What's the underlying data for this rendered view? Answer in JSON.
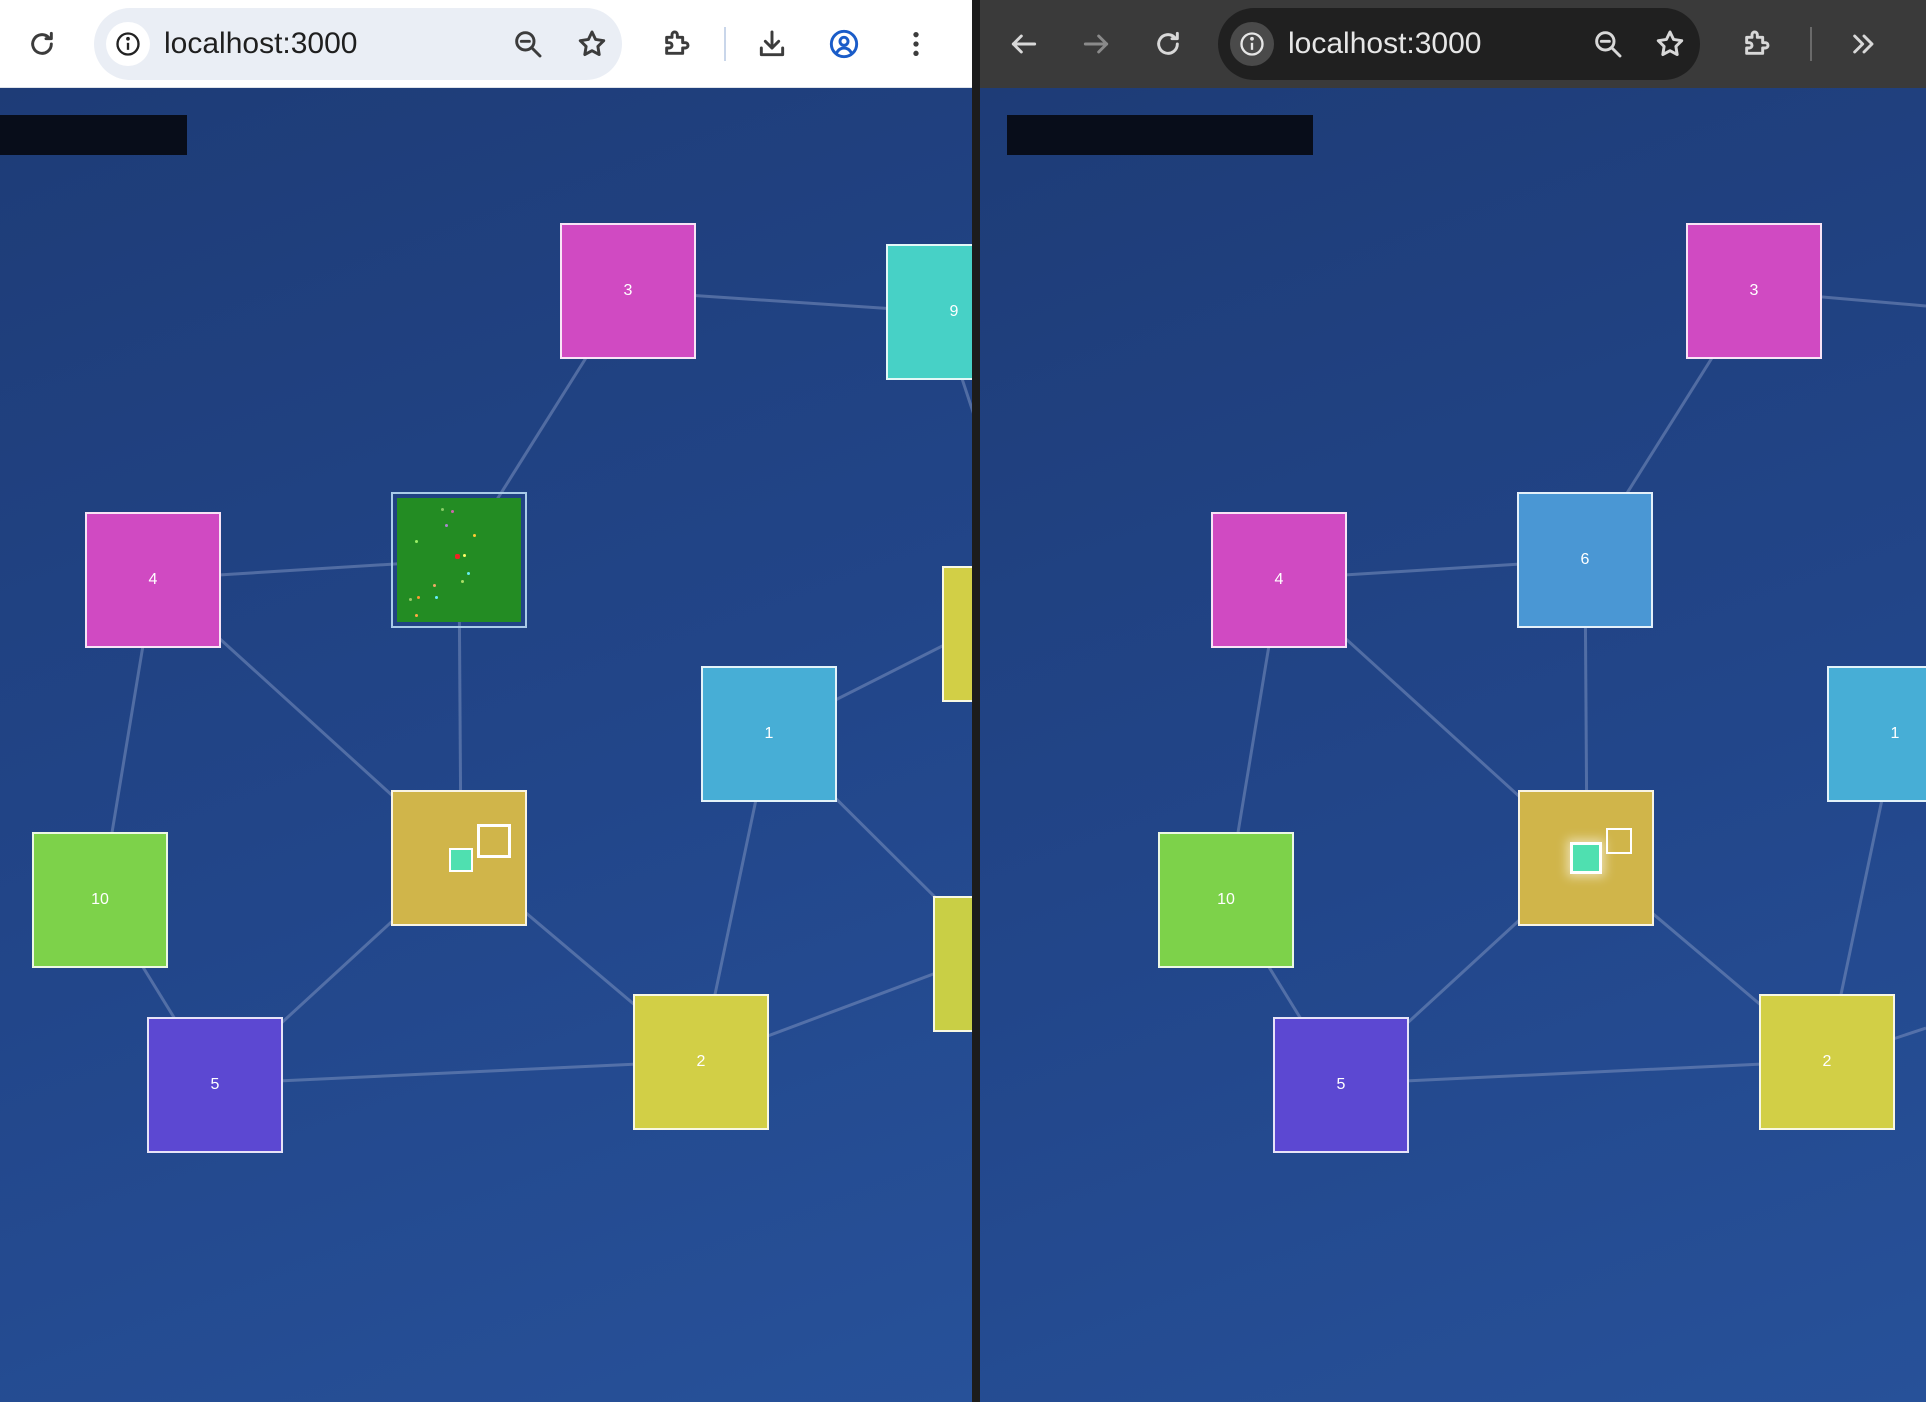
{
  "left_window": {
    "theme": "light",
    "url": "localhost:3000",
    "toolbar_icons": [
      "reload-icon",
      "zoom-out-icon",
      "bookmark-star-icon",
      "extensions-icon",
      "download-icon",
      "profile-icon",
      "menu-icon"
    ]
  },
  "right_window": {
    "theme": "dark",
    "url": "localhost:3000",
    "toolbar_icons": [
      "back-icon",
      "forward-icon",
      "reload-icon",
      "zoom-out-icon",
      "bookmark-star-icon",
      "extensions-icon",
      "overflow-icon"
    ]
  },
  "graph_left": {
    "nodes": [
      {
        "label": "3",
        "color": "#d04ac2"
      },
      {
        "label": "9",
        "color": "#47d1c6"
      },
      {
        "label": "4",
        "color": "#d04ac2"
      },
      {
        "label": "",
        "color": "#d2cf46"
      },
      {
        "label": "1",
        "color": "#47aed6"
      },
      {
        "label": "10",
        "color": "#7dd24a"
      },
      {
        "label": "",
        "color": "#c9cf45"
      },
      {
        "label": "5",
        "color": "#5c48d2"
      },
      {
        "label": "2",
        "color": "#d2cf46"
      }
    ],
    "game_node": {
      "field_color": "#238c23"
    },
    "selected_node": {
      "color": "#d0b54a"
    }
  },
  "graph_right": {
    "nodes": [
      {
        "label": "3",
        "color": "#d04ac2"
      },
      {
        "label": "4",
        "color": "#d04ac2"
      },
      {
        "label": "6",
        "color": "#4a97d4"
      },
      {
        "label": "1",
        "color": "#47aed6"
      },
      {
        "label": "10",
        "color": "#7dd24a"
      },
      {
        "label": "5",
        "color": "#5c48d2"
      },
      {
        "label": "2",
        "color": "#d2cf46"
      }
    ],
    "selected_node": {
      "color": "#d0b54a"
    }
  },
  "colors": {
    "viewport_bg": "#22468a",
    "title_bar": "#080d1a",
    "edge": "#7a8fbd",
    "mini_cyan": "#4fe0b0",
    "profile_blue": "#1a5cc8"
  }
}
